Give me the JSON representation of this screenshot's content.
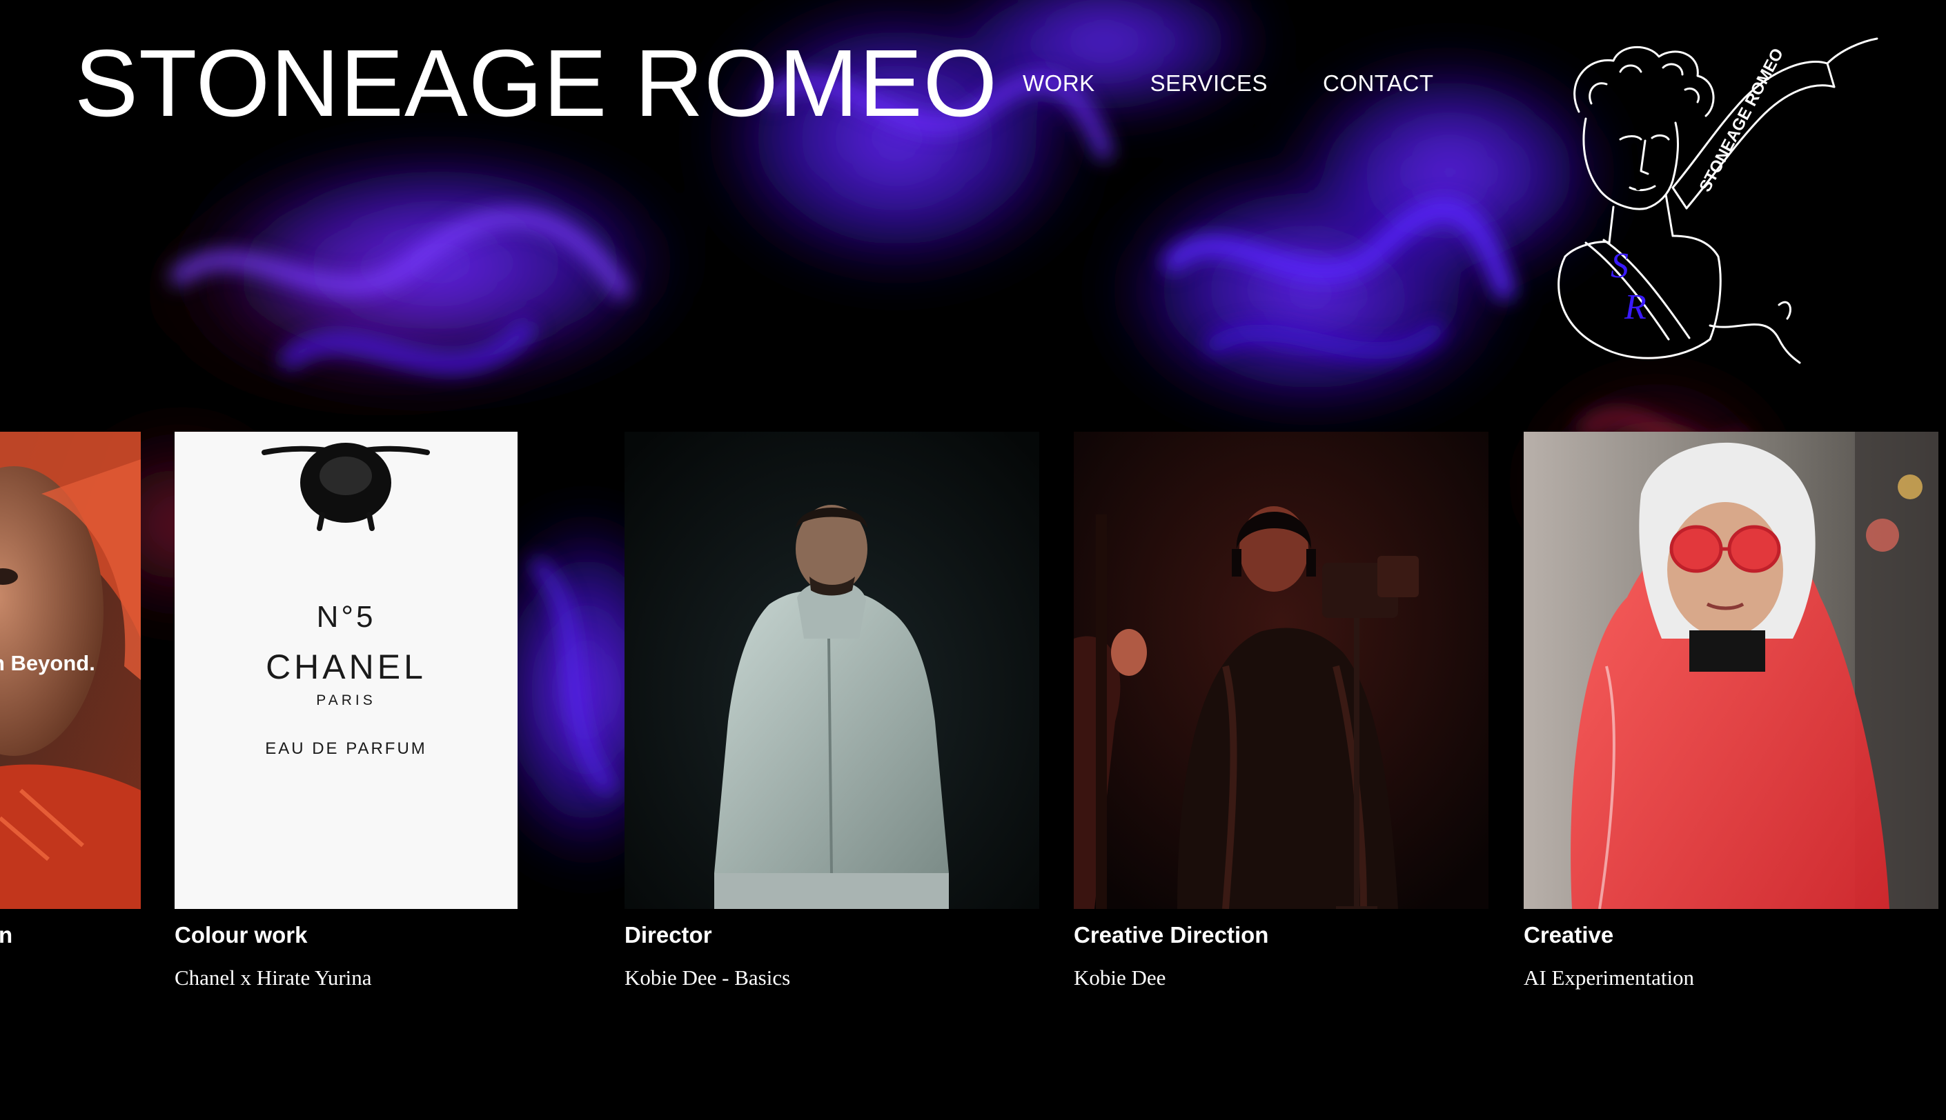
{
  "site": {
    "title": "STONEAGE ROMEO"
  },
  "nav": {
    "items": [
      {
        "label": "WORK"
      },
      {
        "label": "SERVICES"
      },
      {
        "label": "CONTACT"
      }
    ]
  },
  "logo": {
    "text": "STONEAGE ROMEO",
    "initials": [
      "S",
      "R"
    ],
    "icon": "statue-bust-logo"
  },
  "colors": {
    "background": "#000000",
    "smoke_purple": "#5a22ff",
    "smoke_red": "#7a1230",
    "text": "#ffffff"
  },
  "work": {
    "items": [
      {
        "category": "n",
        "project": "",
        "overlay": "h Beyond."
      },
      {
        "category": "Colour work",
        "project": "Chanel x Hirate Yurina",
        "bottle_lines": [
          "N°5",
          "CHANEL",
          "PARIS",
          "EAU DE PARFUM"
        ]
      },
      {
        "category": "Director",
        "project": "Kobie Dee - Basics"
      },
      {
        "category": "Creative Direction",
        "project": "Kobie Dee"
      },
      {
        "category": "Creative",
        "project": "AI Experimentation"
      }
    ]
  }
}
